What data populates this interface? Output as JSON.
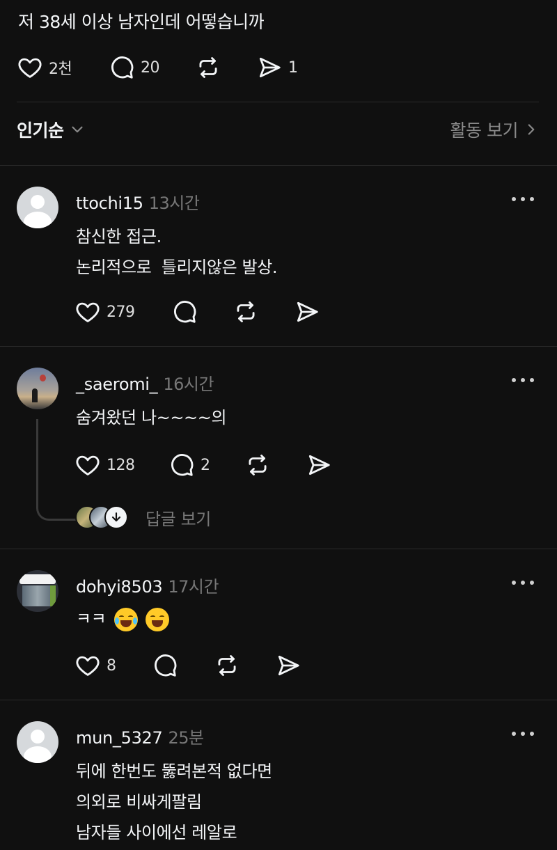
{
  "post": {
    "text": "저 38세 이상 남자인데 어떻습니까",
    "likes": "2천",
    "comments": "20",
    "shares": "1"
  },
  "sort": {
    "label": "인기순",
    "activity_label": "활동 보기"
  },
  "comments": [
    {
      "username": "ttochi15",
      "time": "13시간",
      "lines": [
        "참신한 접근.",
        "논리적으로  틀리지않은 발상."
      ],
      "likes": "279",
      "replies": ""
    },
    {
      "username": "_saeromi_",
      "time": "16시간",
      "lines": [
        "숨겨왔던 나~~~~의"
      ],
      "likes": "128",
      "replies": "2",
      "view_replies_label": "답글 보기"
    },
    {
      "username": "dohyi8503",
      "time": "17시간",
      "lines": [
        "ㅋㅋ"
      ],
      "likes": "8",
      "replies": ""
    },
    {
      "username": "mun_5327",
      "time": "25분",
      "lines": [
        "뒤에 한번도 뚫려본적 없다면",
        "의외로 비싸게팔림",
        "남자들 사이에선 레알로"
      ]
    }
  ],
  "colors": {
    "background": "#101010",
    "text": "#f3f5f7",
    "muted": "#777777",
    "divider": "#2b2b2b"
  }
}
